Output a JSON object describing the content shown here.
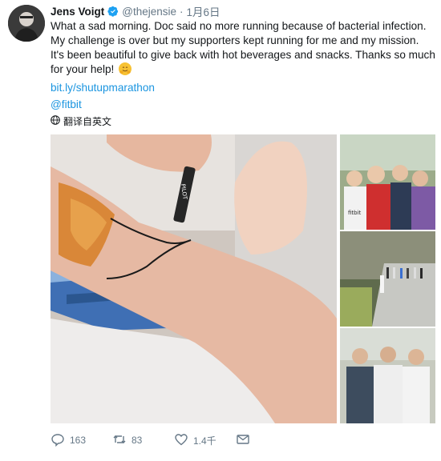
{
  "tweet": {
    "display_name": "Jens Voigt",
    "handle": "@thejensie",
    "separator": "·",
    "date": "1月6日",
    "text": "What a sad morning. Doc said no more running because of bacterial infection. My challenge is over but my supporters kept running for me and my mission. It's been beautiful to give back with hot beverages and snacks. Thanks so much for your help!",
    "link": "bit.ly/shutupmarathon",
    "mention": "@fitbit",
    "translate_label": "翻译自英文",
    "photo_details": {
      "marker_brand": "PILOT",
      "shirt_brand": "fitbit"
    }
  },
  "actions": {
    "replies": "163",
    "retweets": "83",
    "likes": "1.4千"
  },
  "colors": {
    "link": "#1b95e0",
    "muted": "#657786",
    "text": "#14171a",
    "verified": "#1da1f2"
  },
  "icons": [
    "verified-badge-icon",
    "globe-icon",
    "reply-icon",
    "retweet-icon",
    "like-icon",
    "message-icon",
    "hugging-emoji-icon"
  ]
}
